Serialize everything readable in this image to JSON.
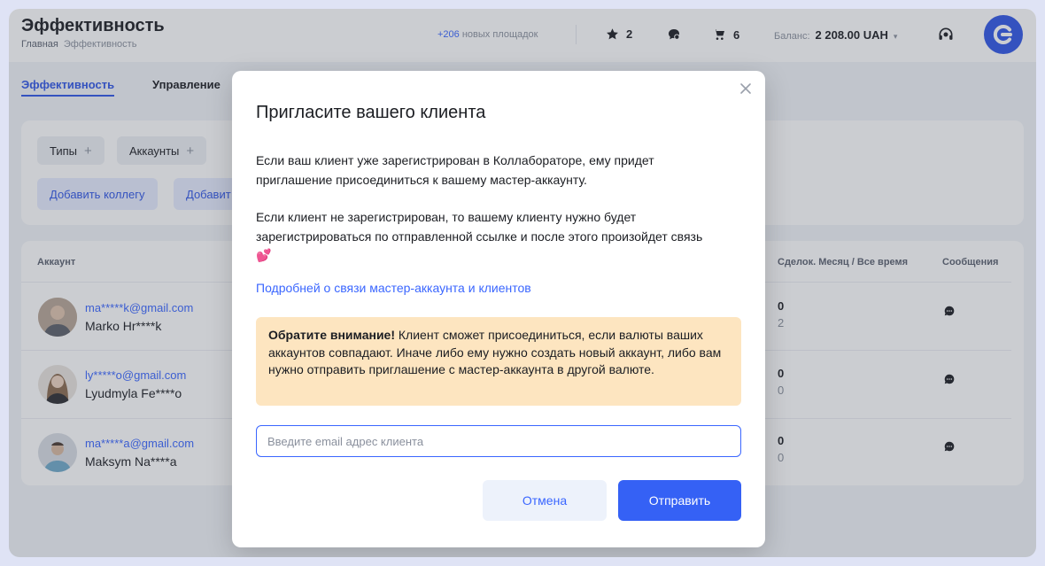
{
  "header": {
    "title": "Эффективность",
    "breadcrumb": [
      "Главная",
      "Эффективность"
    ],
    "new_sites_count": "+206",
    "new_sites_label": "новых площадок",
    "favorites_count": "2",
    "cart_count": "6",
    "balance_label": "Баланс:",
    "balance_value": "2 208.00 UAH"
  },
  "tabs": [
    {
      "label": "Эффективность",
      "active": true
    },
    {
      "label": "Управление",
      "active": false
    }
  ],
  "filters": {
    "chips": [
      "Типы",
      "Аккаунты"
    ],
    "add_colleague": "Добавить коллегу",
    "add_client_partial": "Добавит"
  },
  "table": {
    "headers": {
      "account": "Аккаунт",
      "deals": "Сделок. Месяц / Все время",
      "messages": "Сообщения"
    },
    "rows": [
      {
        "email": "ma*****k@gmail.com",
        "name": "Marko Hr****k",
        "deals_month": "0",
        "deals_all": "2"
      },
      {
        "email": "ly*****o@gmail.com",
        "name": "Lyudmyla Fe****o",
        "deals_month": "0",
        "deals_all": "0"
      },
      {
        "email": "ma*****a@gmail.com",
        "name": "Maksym Na****a",
        "deals_month": "0",
        "deals_all": "0"
      }
    ]
  },
  "modal": {
    "title": "Пригласите вашего клиента",
    "paragraph1": "Если ваш клиент уже зарегистрирован в Коллабораторе, ему придет приглашение присоединиться к вашему мастер-аккаунту.",
    "paragraph2": "Если клиент не зарегистрирован, то вашему клиенту нужно будет зарегистрироваться по отправленной ссылке и после этого произойдет связь 💕",
    "link": "Подробней о связи мастер-аккаунта и клиентов",
    "notice_bold": "Обратите внимание!",
    "notice_text": " Клиент сможет присоединиться, если валюты ваших аккаунтов совпадают. Иначе либо ему нужно создать новый аккаунт, либо вам нужно отправить приглашение с мастер-аккаунта в другой валюте.",
    "input_placeholder": "Введите email адрес клиента",
    "cancel": "Отмена",
    "submit": "Отправить"
  },
  "colors": {
    "accent": "#3561f5",
    "link": "#3a66ff",
    "notice_bg": "#fde5c0"
  }
}
